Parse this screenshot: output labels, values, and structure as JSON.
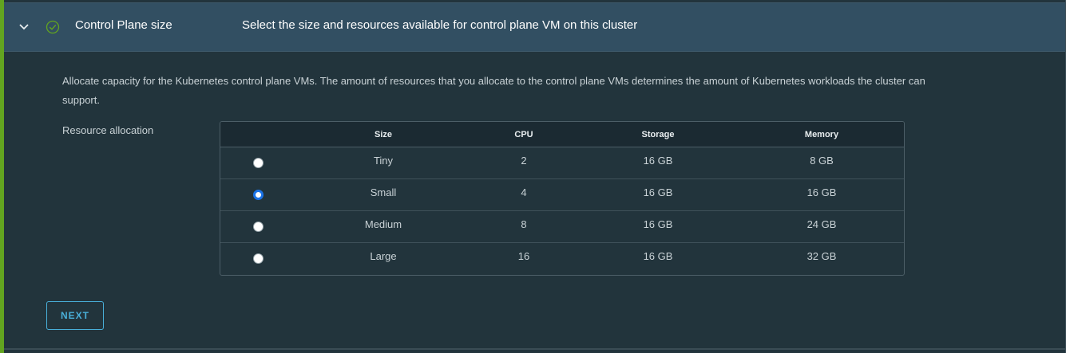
{
  "header": {
    "title": "Control Plane size",
    "description": "Select the size and resources available for control plane VM on this cluster"
  },
  "intro": "Allocate capacity for the Kubernetes control plane VMs. The amount of resources that you allocate to the control plane VMs determines the amount of Kubernetes workloads the cluster can support.",
  "resource_label": "Resource allocation",
  "table": {
    "columns": [
      "Size",
      "CPU",
      "Storage",
      "Memory"
    ],
    "rows": [
      {
        "size": "Tiny",
        "cpu": "2",
        "storage": "16 GB",
        "memory": "8 GB",
        "selected": false
      },
      {
        "size": "Small",
        "cpu": "4",
        "storage": "16 GB",
        "memory": "16 GB",
        "selected": true
      },
      {
        "size": "Medium",
        "cpu": "8",
        "storage": "16 GB",
        "memory": "24 GB",
        "selected": false
      },
      {
        "size": "Large",
        "cpu": "16",
        "storage": "16 GB",
        "memory": "32 GB",
        "selected": false
      }
    ]
  },
  "next_label": "NEXT",
  "colors": {
    "accent_green": "#62a420",
    "header_bg": "#324f62",
    "link_blue": "#49afd9",
    "radio_selected": "#1a73e8"
  },
  "icons": {
    "expand": "chevron-down-icon",
    "status": "check-circle-icon"
  }
}
